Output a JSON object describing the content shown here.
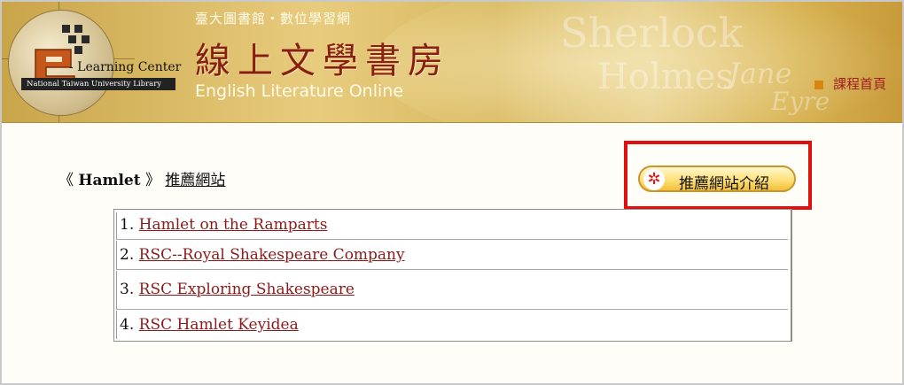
{
  "header": {
    "library_line": "臺大圖書館・數位學習網",
    "title_cn": "線上文學書房",
    "title_en": "English Literature Online",
    "logo_text": "- Learning Center",
    "logo_subtext": "National Taiwan University Library",
    "home_link": "課程首頁",
    "bg_words": [
      "Sherlock",
      "Holmes",
      "Jane",
      "Eyre"
    ]
  },
  "content": {
    "bracket_open": "《",
    "book_title": "Hamlet",
    "bracket_close": "》",
    "section_link": "推薦網站",
    "intro_button": "推薦網站介紹",
    "sites": [
      {
        "num": "1.",
        "title": "Hamlet on the Ramparts"
      },
      {
        "num": "2.",
        "title": "RSC--Royal Shakespeare Company"
      },
      {
        "num": "3.",
        "title": "RSC Exploring Shakespeare"
      },
      {
        "num": "4.",
        "title": "RSC Hamlet Keyidea"
      }
    ]
  },
  "colors": {
    "link": "#8b1a1a",
    "highlight": "#e11010",
    "banner": "#d9b964"
  }
}
